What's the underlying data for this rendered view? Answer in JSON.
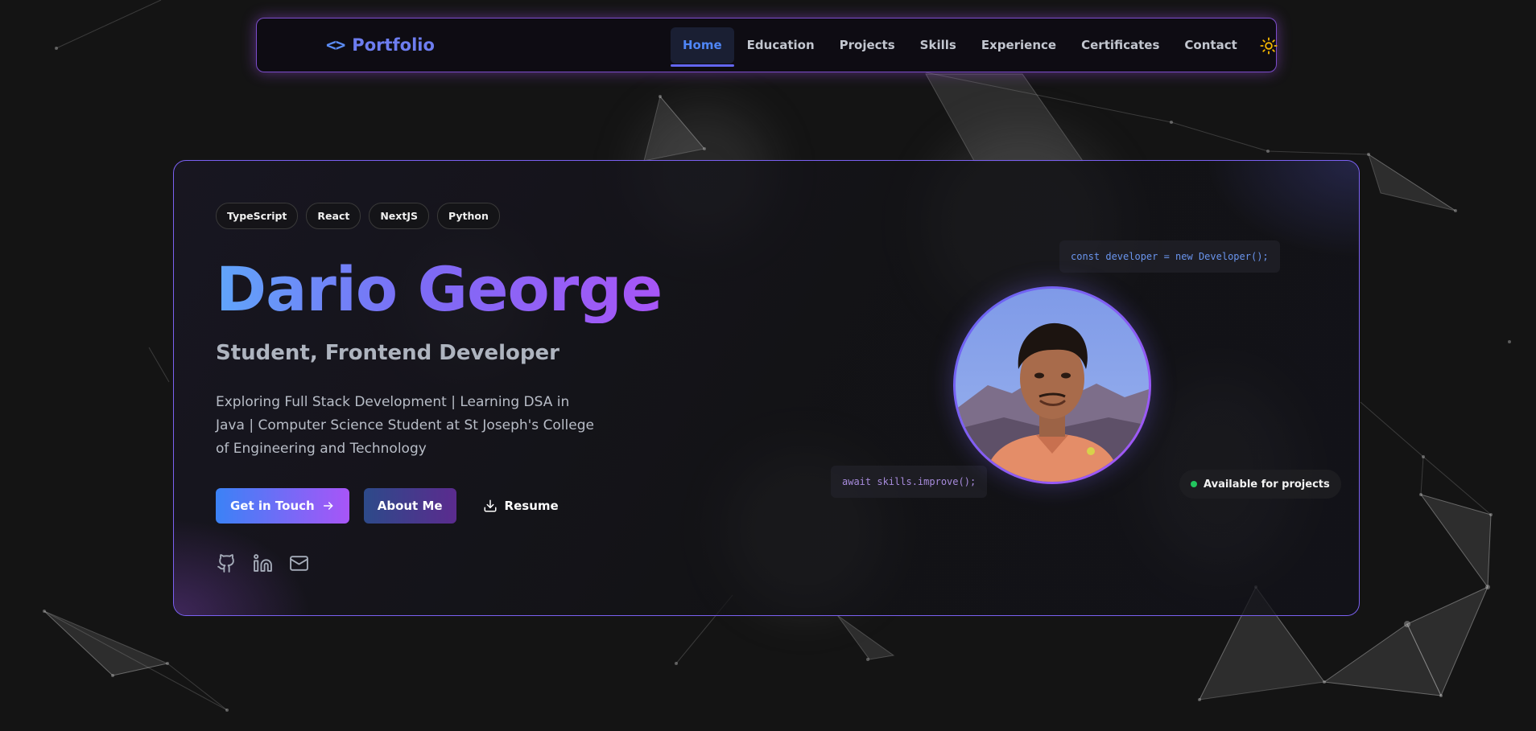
{
  "nav": {
    "logo_icon": "<>",
    "logo_text": "Portfolio",
    "items": [
      {
        "label": "Home",
        "active": true
      },
      {
        "label": "Education"
      },
      {
        "label": "Projects"
      },
      {
        "label": "Skills"
      },
      {
        "label": "Experience"
      },
      {
        "label": "Certificates"
      },
      {
        "label": "Contact"
      }
    ],
    "theme_icon": "sun-icon"
  },
  "hero": {
    "tags": [
      "TypeScript",
      "React",
      "NextJS",
      "Python"
    ],
    "name": "Dario George",
    "role": "Student, Frontend Developer",
    "bio": "Exploring Full Stack Development | Learning DSA in Java | Computer Science Student at St Joseph's College of Engineering and Technology",
    "buttons": {
      "contact": "Get in Touch",
      "about": "About Me",
      "resume": "Resume"
    },
    "socials": [
      "github-icon",
      "linkedin-icon",
      "mail-icon"
    ],
    "code_snippets": [
      "const developer = new Developer();",
      "await skills.improve();"
    ],
    "availability": "Available for projects"
  },
  "colors": {
    "accent_blue": "#3b82f6",
    "accent_purple": "#a855f7",
    "background": "#141414",
    "status_green": "#22c55e"
  }
}
